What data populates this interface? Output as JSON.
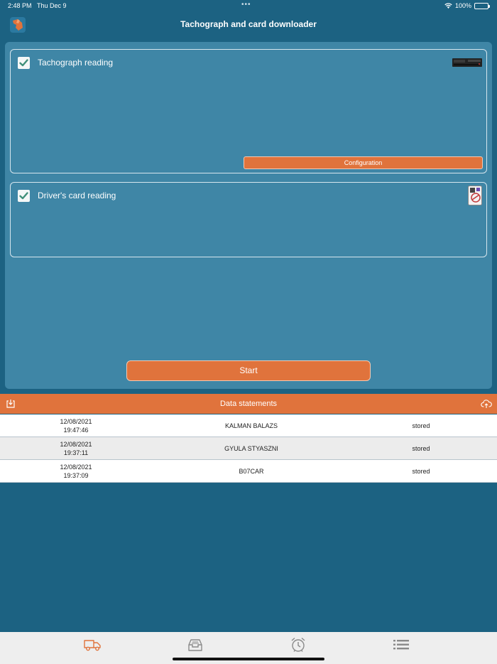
{
  "status_bar": {
    "time": "2:48 PM",
    "date": "Thu Dec 9",
    "battery": "100%"
  },
  "header": {
    "title": "Tachograph and card downloader"
  },
  "tachograph": {
    "label": "Tachograph reading",
    "checked": true,
    "config_label": "Configuration"
  },
  "driver_card": {
    "label": "Driver's card reading",
    "checked": true
  },
  "start_label": "Start",
  "statements": {
    "title": "Data statements",
    "rows": [
      {
        "date": "12/08/2021",
        "time": "19:47:46",
        "name": "KALMAN BALAZS",
        "status": "stored"
      },
      {
        "date": "12/08/2021",
        "time": "19:37:11",
        "name": "GYULA STYASZNI",
        "status": "stored"
      },
      {
        "date": "12/08/2021",
        "time": "19:37:09",
        "name": "B07CAR",
        "status": "stored"
      }
    ]
  },
  "tabs": [
    {
      "icon": "truck-icon",
      "active": true
    },
    {
      "icon": "archive-icon",
      "active": false
    },
    {
      "icon": "alarm-clock-icon",
      "active": false
    },
    {
      "icon": "list-icon",
      "active": false
    }
  ],
  "colors": {
    "background": "#1c6282",
    "panel": "#3f86a6",
    "accent": "#e0733c",
    "tab_active": "#e0733c",
    "tab_inactive": "#8a8a8a"
  }
}
